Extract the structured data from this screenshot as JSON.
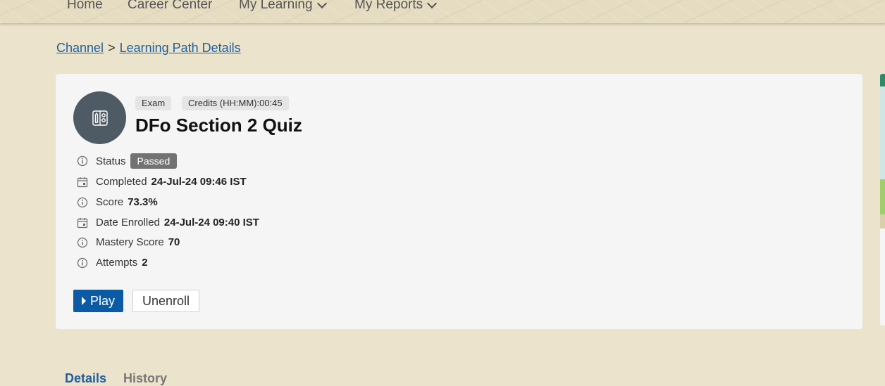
{
  "nav": {
    "items": [
      {
        "label": "Home"
      },
      {
        "label": "Career Center"
      },
      {
        "label": "My Learning"
      },
      {
        "label": "My Reports"
      }
    ]
  },
  "breadcrumb": {
    "items": [
      "Channel",
      "Learning Path Details"
    ],
    "separator": ">"
  },
  "item": {
    "type_tag": "Exam",
    "credits_tag": "Credits (HH:MM):00:45",
    "title": "DFo Section 2 Quiz",
    "icon": "exam-icon"
  },
  "details": {
    "status_label": "Status",
    "status_value": "Passed",
    "completed_label": "Completed",
    "completed_value": "24-Jul-24 09:46 IST",
    "score_label": "Score",
    "score_value": "73.3%",
    "enrolled_label": "Date Enrolled",
    "enrolled_value": "24-Jul-24 09:40 IST",
    "mastery_label": "Mastery Score",
    "mastery_value": "70",
    "attempts_label": "Attempts",
    "attempts_value": "2"
  },
  "actions": {
    "play_label": "Play",
    "unenroll_label": "Unenroll"
  },
  "tabs": [
    {
      "label": "Details"
    },
    {
      "label": "History"
    }
  ],
  "colors": {
    "background": "#ebe3cc",
    "primary": "#0b5aa5",
    "link": "#1f5f9e",
    "badge": "#727272",
    "avatar": "#4e5b64"
  }
}
